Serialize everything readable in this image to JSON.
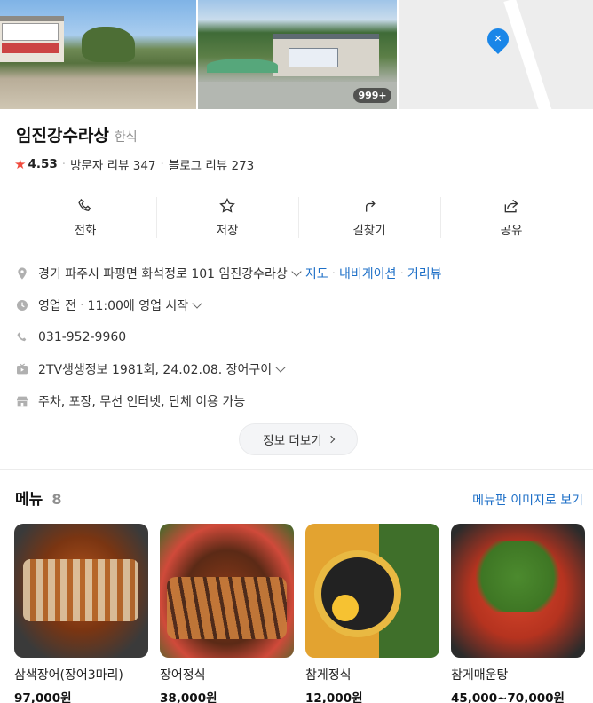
{
  "photos": {
    "count_badge": "999+"
  },
  "place": {
    "name": "임진강수라상",
    "category": "한식",
    "rating": "4.53",
    "visitor_reviews": "방문자 리뷰 347",
    "blog_reviews": "블로그 리뷰 273"
  },
  "actions": [
    {
      "label": "전화",
      "icon": "phone-icon"
    },
    {
      "label": "저장",
      "icon": "star-outline-icon"
    },
    {
      "label": "길찾기",
      "icon": "directions-icon"
    },
    {
      "label": "공유",
      "icon": "share-icon"
    }
  ],
  "info": {
    "address": "경기 파주시 파평면 화석정로 101 임진강수라상",
    "map_link": "지도",
    "navi_link": "내비게이션",
    "street_link": "거리뷰",
    "hours_status": "영업 전",
    "hours_open": "11:00에 영업 시작",
    "phone": "031-952-9960",
    "tv": "2TV생생정보 1981회, 24.02.08. 장어구이",
    "amenities": "주차, 포장, 무선 인터넷, 단체 이용 가능",
    "more_button": "정보 더보기"
  },
  "menu": {
    "title": "메뉴",
    "count": "8",
    "image_link": "메뉴판 이미지로 보기",
    "items": [
      {
        "name": "삼색장어(장어3마리)",
        "price": "97,000원"
      },
      {
        "name": "장어정식",
        "price": "38,000원"
      },
      {
        "name": "참게정식",
        "price": "12,000원"
      },
      {
        "name": "참게매운탕",
        "price": "45,000~70,000원"
      }
    ]
  },
  "colors": {
    "accent_link": "#1d6fc7",
    "rating_star": "#f04b3e",
    "map_pin": "#1a86e8"
  }
}
